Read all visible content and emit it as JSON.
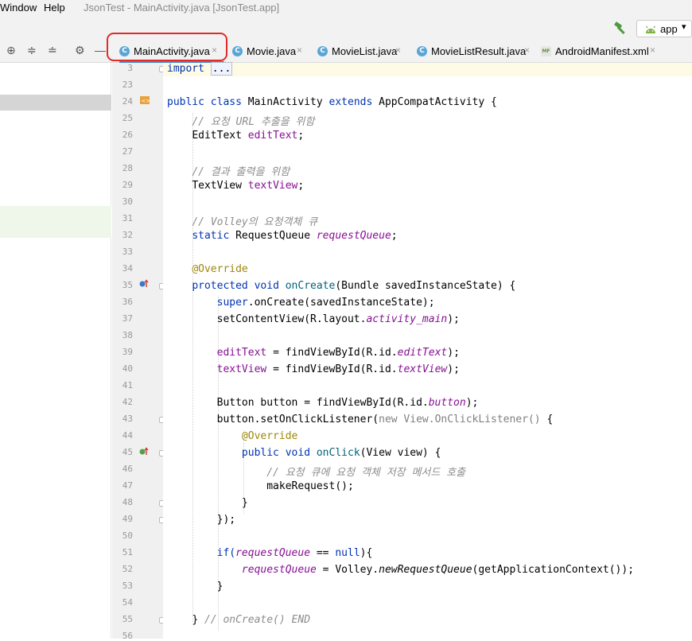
{
  "menu": {
    "window": "Window",
    "help": "Help",
    "title": "JsonTest - MainActivity.java [JsonTest.app]"
  },
  "toolbar": {
    "run_config": "app",
    "run_config_caret": "▾"
  },
  "sidebar_tools": [
    "⊕",
    "≑",
    "≐",
    "⚙",
    "—"
  ],
  "tabs": [
    {
      "label": "MainActivity.java",
      "icon": "C",
      "close": "×"
    },
    {
      "label": "Movie.java",
      "icon": "C",
      "close": "×"
    },
    {
      "label": "MovieList.java",
      "icon": "C",
      "close": "×"
    },
    {
      "label": "MovieListResult.java",
      "icon": "C",
      "close": "×"
    },
    {
      "label": "AndroidManifest.xml",
      "icon": "MF",
      "close": "×"
    }
  ],
  "line_numbers": [
    "3",
    "23",
    "24",
    "25",
    "26",
    "27",
    "28",
    "29",
    "30",
    "31",
    "32",
    "33",
    "34",
    "35",
    "36",
    "37",
    "38",
    "39",
    "40",
    "41",
    "42",
    "43",
    "44",
    "45",
    "46",
    "47",
    "48",
    "49",
    "50",
    "51",
    "52",
    "53",
    "54",
    "55",
    "56"
  ],
  "code": {
    "import_kw": "import",
    "import_fold": "...",
    "l24_public": "public",
    "l24_class": "class",
    "l24_name": "MainActivity",
    "l24_extends": "extends",
    "l24_rest": "AppCompatActivity {",
    "l25": "// 요청 URL 추출을 위함",
    "l26_type": "EditText",
    "l26_field": "editText",
    "l26_end": ";",
    "l28": "// 결과 출력을 위함",
    "l29_type": "TextView",
    "l29_field": "textView",
    "l29_end": ";",
    "l31": "// Volley의 요청객체 큐",
    "l32_static": "static",
    "l32_type": "RequestQueue",
    "l32_field": "requestQueue",
    "l32_end": ";",
    "l34": "@Override",
    "l35_protected": "protected",
    "l35_void": "void",
    "l35_method": "onCreate",
    "l35_rest": "(Bundle savedInstanceState) {",
    "l36_super": "super",
    "l36_rest": ".onCreate(savedInstanceState);",
    "l37_a": "setContentView(R.layout.",
    "l37_b": "activity_main",
    "l37_c": ");",
    "l39_a": "editText",
    "l39_b": " = findViewById(R.id.",
    "l39_c": "editText",
    "l39_d": ");",
    "l40_a": "textView",
    "l40_b": " = findViewById(R.id.",
    "l40_c": "textView",
    "l40_d": ");",
    "l42_a": "Button button = findViewById(R.id.",
    "l42_b": "button",
    "l42_c": ");",
    "l43_a": "button.setOnClickListener(",
    "l43_b": "new View.OnClickListener()",
    "l43_c": " {",
    "l44": "@Override",
    "l45_public": "public",
    "l45_void": "void",
    "l45_method": "onClick",
    "l45_rest": "(View view) {",
    "l46": "// 요청 큐에 요청 객체 저장 메서드 호출",
    "l47": "makeRequest();",
    "l48": "}",
    "l49": "});",
    "l51_a": "if(",
    "l51_b": "requestQueue",
    "l51_c": " == ",
    "l51_d": "null",
    "l51_e": "){",
    "l52_a": "requestQueue",
    "l52_b": " = Volley.",
    "l52_c": "newRequestQueue",
    "l52_d": "(getApplicationContext());",
    "l53": "}",
    "l55_a": "}",
    "l55_b": "// onCreate() END"
  },
  "colors": {
    "keyword": "#0033b3",
    "field": "#871094",
    "comment": "#8c8c8c",
    "annotation": "#9e880d",
    "method": "#00627a",
    "highlight_ring": "#e12a2a"
  },
  "icons": [
    "hammer-icon",
    "android-icon",
    "java-class-icon",
    "manifest-icon",
    "gear-icon",
    "locate-icon",
    "expand-all-icon",
    "collapse-all-icon",
    "override-marker-icon",
    "implement-marker-icon",
    "xml-layout-marker-icon"
  ]
}
